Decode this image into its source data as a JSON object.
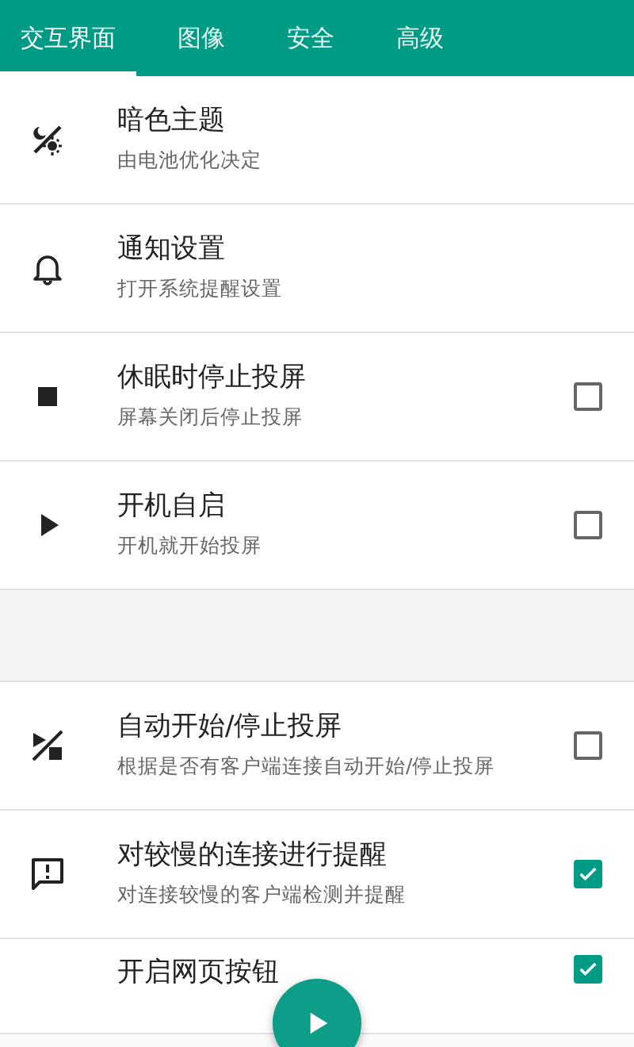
{
  "tabs": [
    {
      "label": "交互界面",
      "selected": true
    },
    {
      "label": "图像",
      "selected": false
    },
    {
      "label": "安全",
      "selected": false
    },
    {
      "label": "高级",
      "selected": false
    }
  ],
  "groups": [
    {
      "items": [
        {
          "kind": "plain",
          "title": "暗色主题",
          "subtitle": "由电池优化决定"
        },
        {
          "kind": "plain",
          "title": "通知设置",
          "subtitle": "打开系统提醒设置"
        },
        {
          "kind": "checkbox",
          "title": "休眠时停止投屏",
          "subtitle": "屏幕关闭后停止投屏",
          "checked": false
        },
        {
          "kind": "checkbox",
          "title": "开机自启",
          "subtitle": "开机就开始投屏",
          "checked": false
        }
      ]
    },
    {
      "items": [
        {
          "kind": "checkbox",
          "title": "自动开始/停止投屏",
          "subtitle": "根据是否有客户端连接自动开始/停止投屏",
          "checked": false
        },
        {
          "kind": "checkbox",
          "title": "对较慢的连接进行提醒",
          "subtitle": "对连接较慢的客户端检测并提醒",
          "checked": true
        },
        {
          "kind": "checkbox",
          "title": "开启网页按钮",
          "checked": true
        }
      ]
    }
  ],
  "fab": {
    "kind": "play"
  }
}
